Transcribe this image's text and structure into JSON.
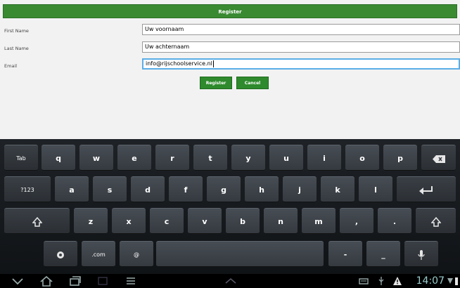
{
  "form": {
    "title": "Register",
    "first_name_label": "First Name",
    "first_name_value": "Uw voornaam",
    "last_name_label": "Last Name",
    "last_name_value": "Uw achternaam",
    "email_label": "Email",
    "email_value": "info@rijschoolservice.nl",
    "register_label": "Register",
    "cancel_label": "Cancel",
    "accent_color": "#3a8a32"
  },
  "keyboard": {
    "row1": [
      "Tab",
      "q",
      "w",
      "e",
      "r",
      "t",
      "y",
      "u",
      "i",
      "o",
      "p"
    ],
    "row2": [
      "?123",
      "a",
      "s",
      "d",
      "f",
      "g",
      "h",
      "j",
      "k",
      "l"
    ],
    "row3": [
      "z",
      "x",
      "c",
      "v",
      "b",
      "n",
      "m",
      ",",
      "."
    ],
    "row4": [
      ".com",
      "@",
      "-",
      "_"
    ]
  },
  "status": {
    "time": "14:07"
  }
}
